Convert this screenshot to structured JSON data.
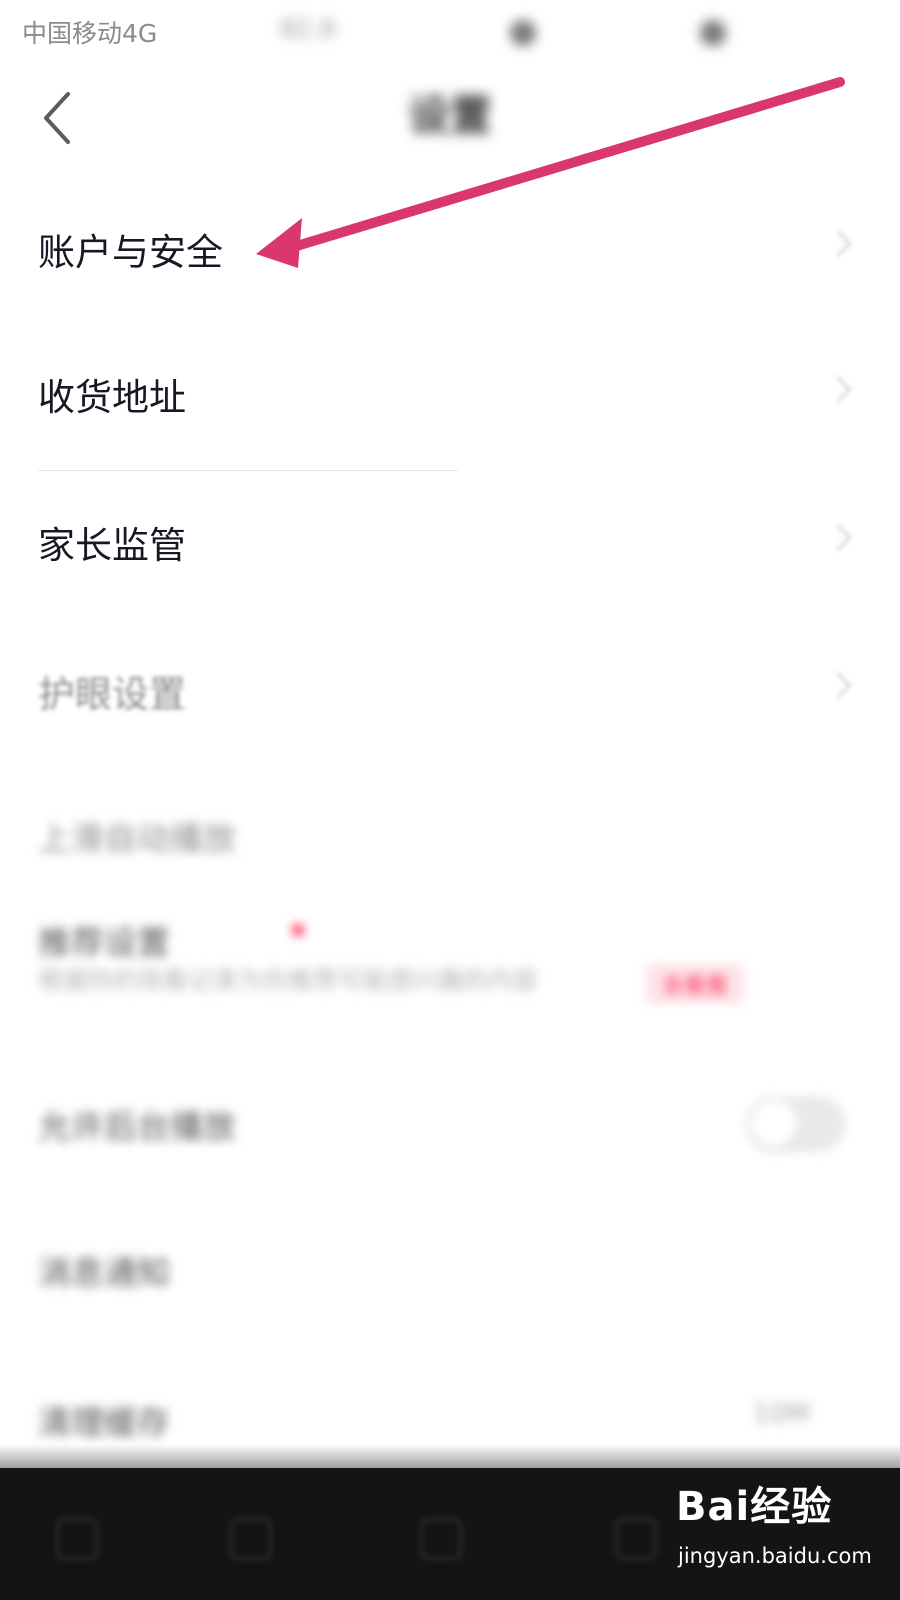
{
  "status_bar": {
    "carrier": "中国移动4G",
    "speed": "82.8"
  },
  "nav": {
    "title": "设置"
  },
  "settings": {
    "items": [
      {
        "label": "账户与安全"
      },
      {
        "label": "收货地址"
      },
      {
        "label": "家长监管"
      },
      {
        "label": "护眼设置"
      },
      {
        "label": "上滑自动播放"
      },
      {
        "label": "推荐设置"
      },
      {
        "label": "允许后台播放"
      },
      {
        "label": "消息通知"
      },
      {
        "label": "清理缓存"
      }
    ],
    "recommend_subtitle": "根据你的观看记录为你推荐可能感兴趣的内容",
    "recommend_pill": "去看看",
    "cache_size": "10M"
  },
  "watermark": {
    "logo_text": "Bai经验",
    "url": "jingyan.baidu.com"
  },
  "colors": {
    "arrow": "#d9376e",
    "accent": "#fe2c55",
    "text": "#161823"
  }
}
